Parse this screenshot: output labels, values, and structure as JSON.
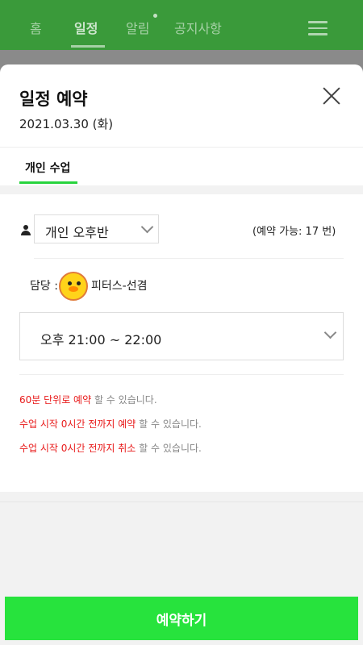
{
  "nav": {
    "tabs": [
      {
        "label": "홈"
      },
      {
        "label": "일정"
      },
      {
        "label": "알림"
      },
      {
        "label": "공지사항"
      }
    ],
    "active_tab": "일정"
  },
  "modal": {
    "title": "일정 예약",
    "date": "2021.03.30 (화)",
    "tab_label": "개인 수업",
    "class_select": {
      "value": "개인 오후반"
    },
    "availability": "(예약 가능: 17 번)",
    "instructor": {
      "label": "담당 :",
      "name": "피터스-선겸"
    },
    "time_select": {
      "value": "오후 21:00 ~ 22:00"
    },
    "notes": [
      {
        "red": "60분 단위로 예약",
        "gray": " 할 수 있습니다."
      },
      {
        "red": "수업 시작 0시간 전까지 예약",
        "gray": " 할 수 있습니다."
      },
      {
        "red": "수업 시작 0시간 전까지 취소",
        "gray": " 할 수 있습니다."
      }
    ],
    "book_button": "예약하기"
  },
  "colors": {
    "nav_bg": "#3a9a3a",
    "accent_green": "#27e33d",
    "note_red": "#e81919",
    "note_gray": "#888888"
  },
  "icons": [
    "menu-icon",
    "close-icon",
    "person-icon",
    "chevron-down-icon",
    "avatar-duck"
  ]
}
